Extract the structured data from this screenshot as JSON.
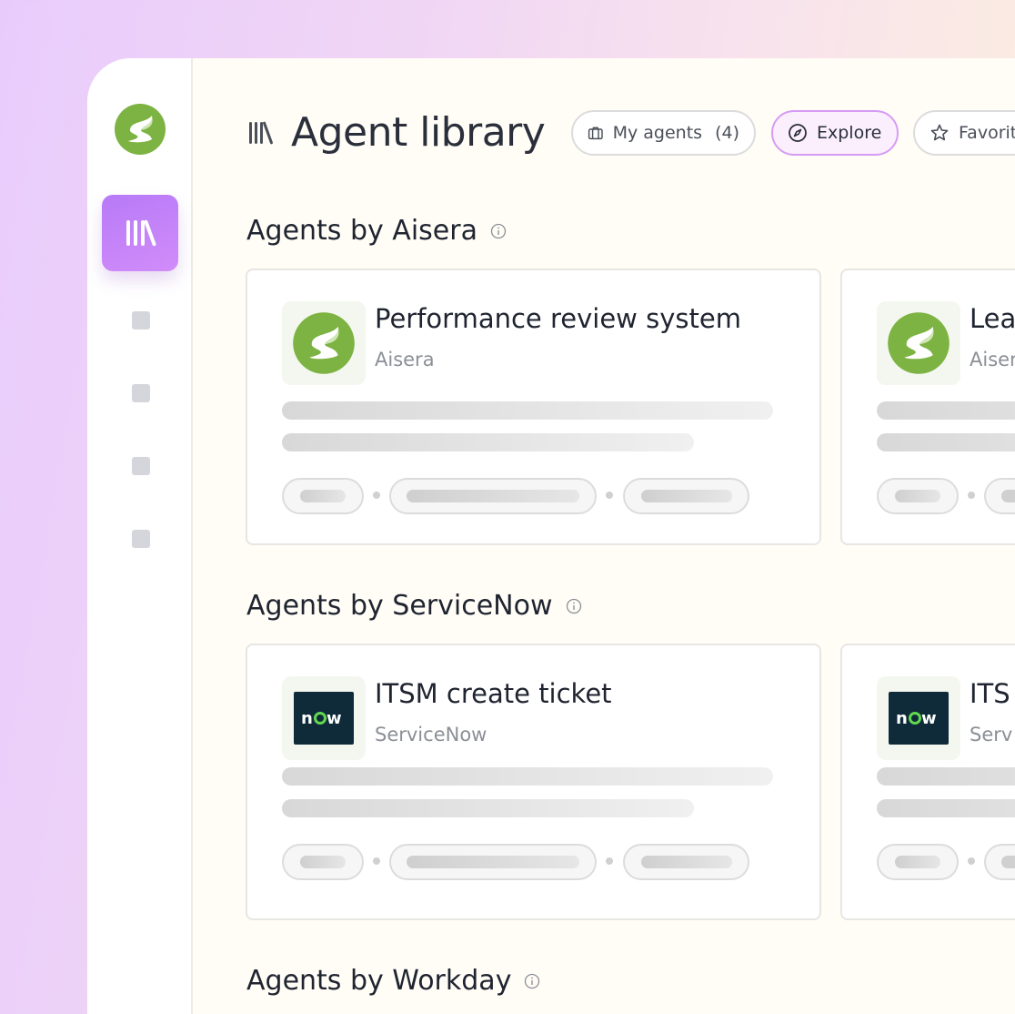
{
  "app": {
    "title": "Agent library",
    "accent_color": "#c084fc",
    "brand_color": "#7cb342"
  },
  "sidebar": {
    "items": [
      {
        "icon": "library-icon",
        "active": true
      },
      {
        "icon": "placeholder-icon",
        "active": false
      },
      {
        "icon": "placeholder-icon",
        "active": false
      },
      {
        "icon": "placeholder-icon",
        "active": false
      },
      {
        "icon": "placeholder-icon",
        "active": false
      }
    ]
  },
  "header": {
    "tabs": [
      {
        "label": "My agents",
        "count": "(4)",
        "icon": "briefcase-icon"
      },
      {
        "label": "Explore",
        "icon": "compass-icon",
        "active": true
      },
      {
        "label": "Favorit",
        "icon": "star-icon"
      }
    ]
  },
  "sections": [
    {
      "title": "Agents by Aisera",
      "cards": [
        {
          "title": "Performance review system",
          "vendor": "Aisera",
          "logo": "aisera-logo"
        },
        {
          "title": "Lea",
          "vendor": "Aiser",
          "logo": "aisera-logo"
        }
      ]
    },
    {
      "title": "Agents by ServiceNow",
      "cards": [
        {
          "title": "ITSM create ticket",
          "vendor": "ServiceNow",
          "logo": "servicenow-logo",
          "logo_text": "now"
        },
        {
          "title": "ITS",
          "vendor": "Serv",
          "logo": "servicenow-logo",
          "logo_text": "now"
        }
      ]
    },
    {
      "title": "Agents by Workday",
      "cards": []
    }
  ]
}
